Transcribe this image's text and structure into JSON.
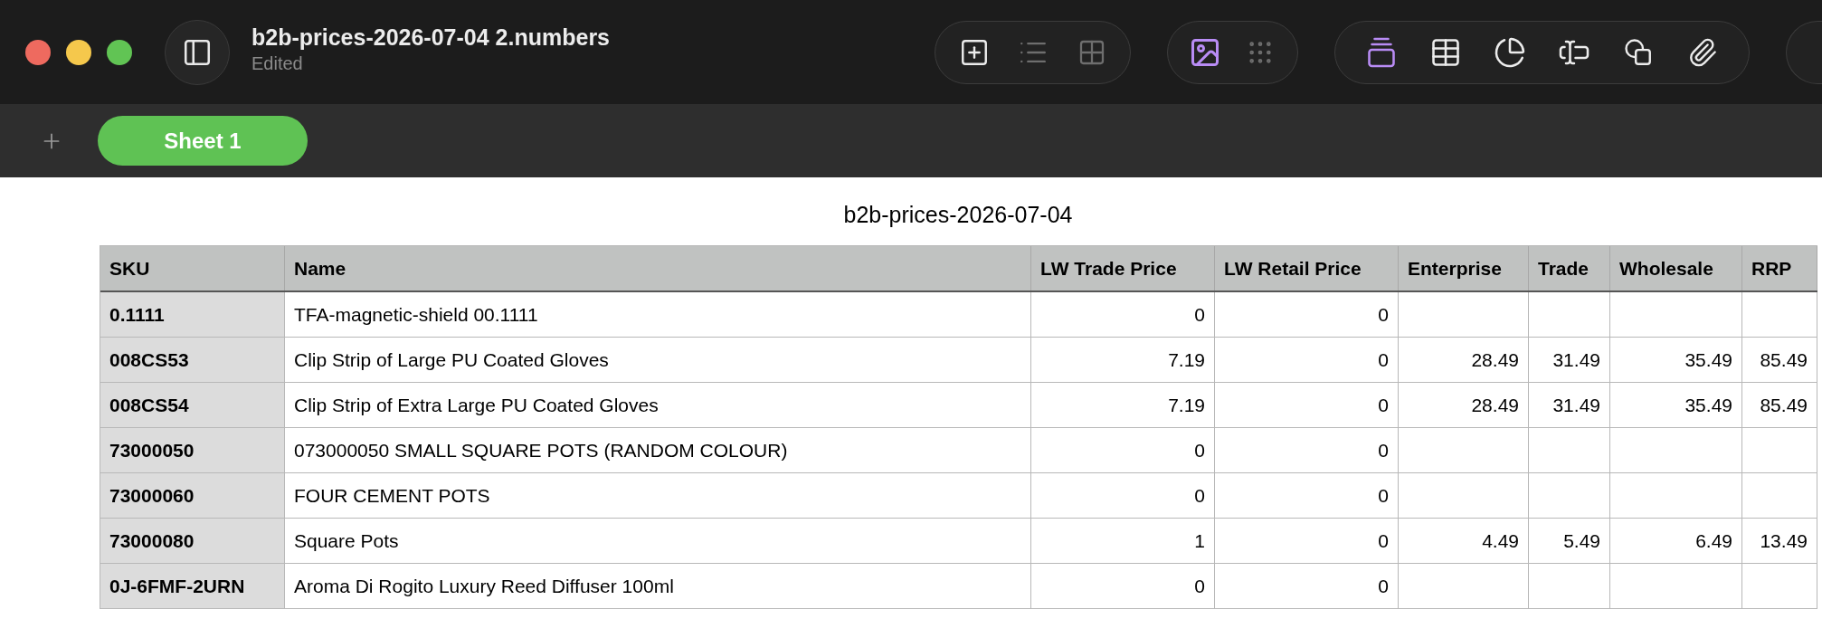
{
  "window": {
    "title": "b2b-prices-2026-07-04 2.numbers",
    "subtitle": "Edited"
  },
  "tabs": [
    {
      "label": "Sheet 1",
      "selected": true
    }
  ],
  "table": {
    "title": "b2b-prices-2026-07-04",
    "columns": [
      {
        "label": "SKU",
        "kind": "row_header"
      },
      {
        "label": "Name",
        "kind": "text"
      },
      {
        "label": "LW Trade Price",
        "kind": "number"
      },
      {
        "label": "LW Retail Price",
        "kind": "number"
      },
      {
        "label": "Enterprise",
        "kind": "number"
      },
      {
        "label": "Trade",
        "kind": "number"
      },
      {
        "label": "Wholesale",
        "kind": "number"
      },
      {
        "label": "RRP",
        "kind": "number"
      }
    ],
    "rows": [
      [
        "0.1111",
        "TFA-magnetic-shield 00.1111",
        "0",
        "0",
        null,
        null,
        null,
        null
      ],
      [
        "008CS53",
        "Clip Strip of Large PU Coated Gloves",
        "7.19",
        "0",
        "28.49",
        "31.49",
        "35.49",
        "85.49"
      ],
      [
        "008CS54",
        "Clip Strip of Extra Large PU Coated Gloves",
        "7.19",
        "0",
        "28.49",
        "31.49",
        "35.49",
        "85.49"
      ],
      [
        "73000050",
        "073000050 SMALL SQUARE POTS (RANDOM COLOUR)",
        "0",
        "0",
        null,
        null,
        null,
        null
      ],
      [
        "73000060",
        "FOUR CEMENT POTS",
        "0",
        "0",
        null,
        null,
        null,
        null
      ],
      [
        "73000080",
        "Square Pots",
        "1",
        "0",
        "4.49",
        "5.49",
        "6.49",
        "13.49"
      ],
      [
        "0J-6FMF-2URN",
        "Aroma Di Rogito Luxury Reed Diffuser 100ml",
        "0",
        "0",
        null,
        null,
        null,
        null
      ]
    ]
  }
}
